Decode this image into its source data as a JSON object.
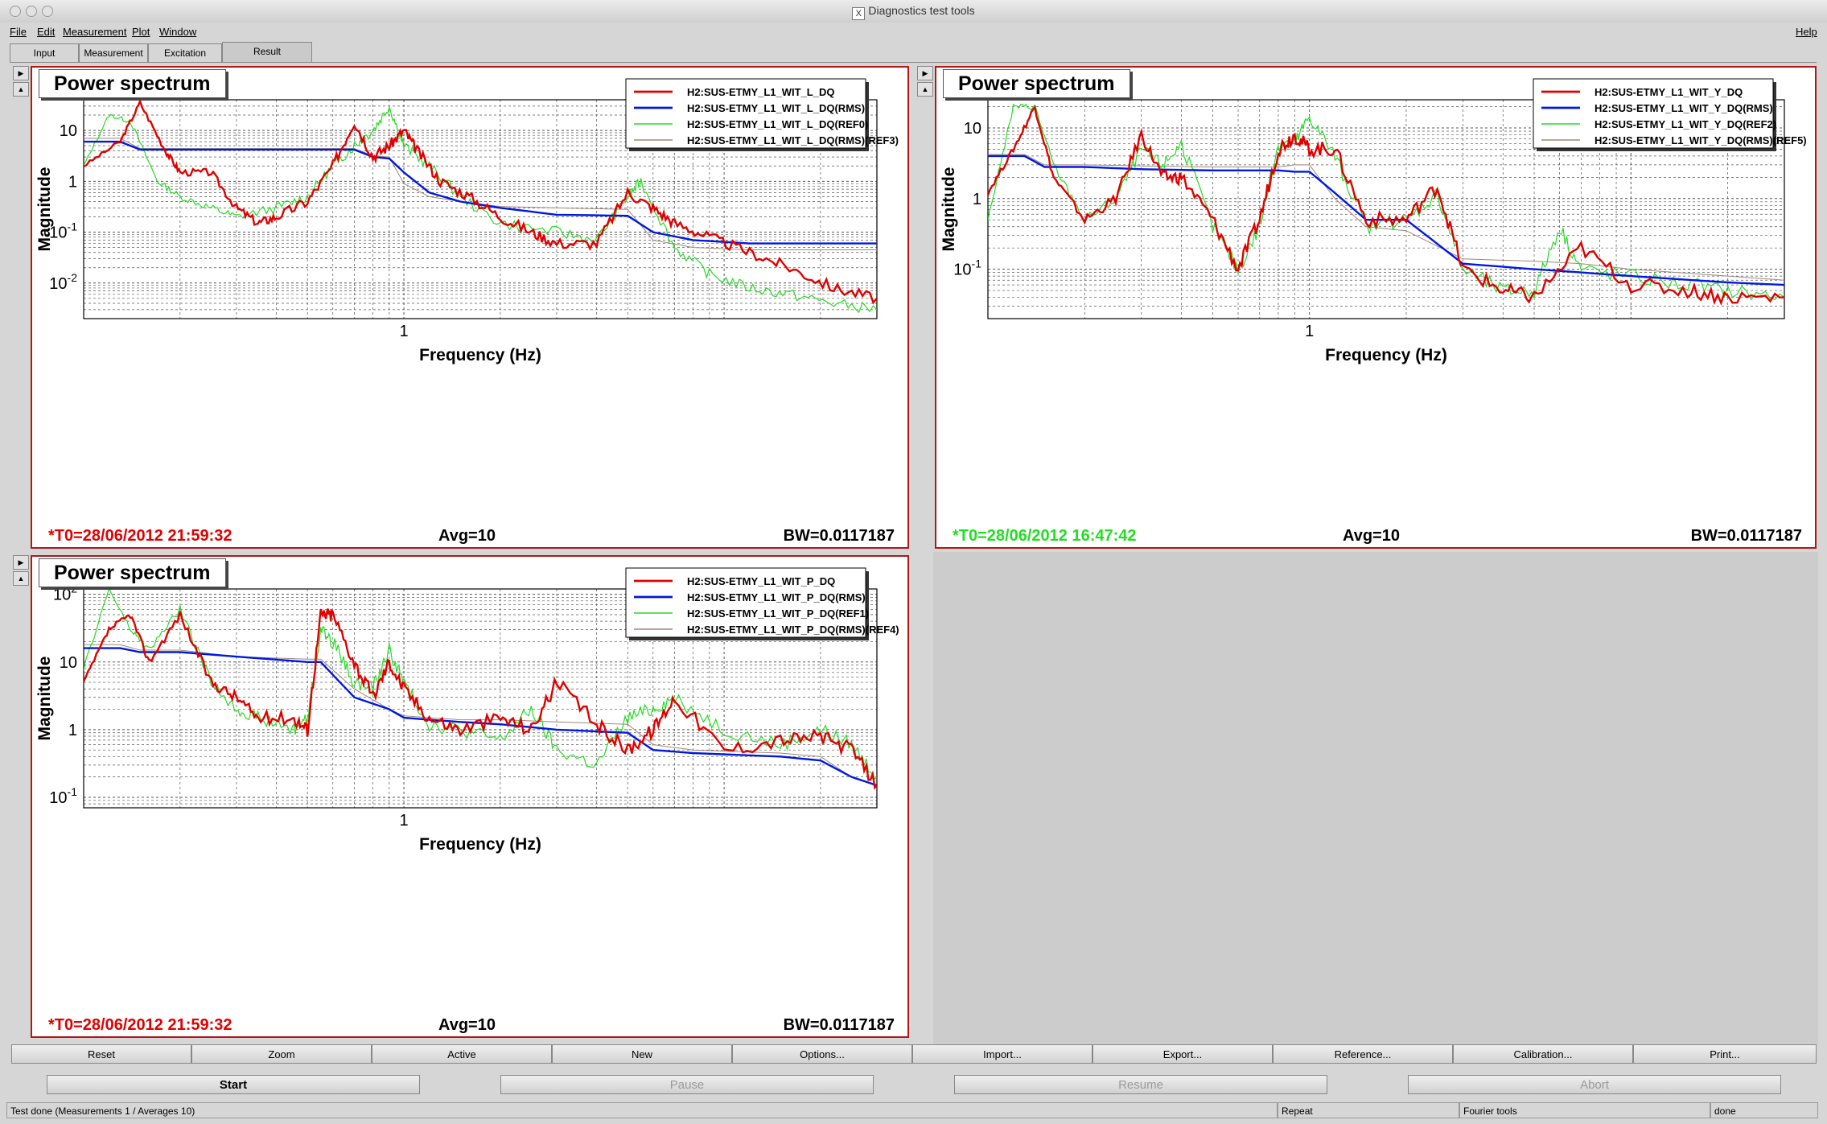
{
  "window": {
    "title": "Diagnostics test tools"
  },
  "menu": {
    "items": [
      "File",
      "Edit",
      "Measurement",
      "Plot",
      "Window"
    ],
    "help": "Help"
  },
  "tabs": [
    {
      "label": "Input",
      "active": false
    },
    {
      "label": "Measurement",
      "active": false
    },
    {
      "label": "Excitation",
      "active": false
    },
    {
      "label": "Result",
      "active": true
    }
  ],
  "colors": {
    "red": "#e00000",
    "blue": "#0018e0",
    "green": "#22dd22",
    "brown": "#a08878",
    "frame": "#b01818"
  },
  "plots": [
    {
      "title": "Power spectrum",
      "ylabel": "Magnitude",
      "xlabel": "Frequency (Hz)",
      "ytick_labels": [
        "10",
        "1",
        "10",
        "10"
      ],
      "ytick_exps": [
        "",
        "",
        "-1",
        "-2"
      ],
      "xtick_label": "1",
      "legend": [
        "H2:SUS-ETMY_L1_WIT_L_DQ",
        "H2:SUS-ETMY_L1_WIT_L_DQ(RMS)",
        "H2:SUS-ETMY_L1_WIT_L_DQ(REF0)",
        "H2:SUS-ETMY_L1_WIT_L_DQ(RMS)(REF3)"
      ],
      "t0": "*T0=28/06/2012 21:59:32",
      "t0_color": "#e00000",
      "avg": "Avg=10",
      "bw": "BW=0.0117187"
    },
    {
      "title": "Power spectrum",
      "ylabel": "Magnitude",
      "xlabel": "Frequency (Hz)",
      "ytick_labels": [
        "10",
        "1",
        "10"
      ],
      "ytick_exps": [
        "",
        "",
        "-1"
      ],
      "xtick_label": "1",
      "legend": [
        "H2:SUS-ETMY_L1_WIT_Y_DQ",
        "H2:SUS-ETMY_L1_WIT_Y_DQ(RMS)",
        "H2:SUS-ETMY_L1_WIT_Y_DQ(REF2)",
        "H2:SUS-ETMY_L1_WIT_Y_DQ(RMS)(REF5)"
      ],
      "t0": "*T0=28/06/2012 16:47:42",
      "t0_color": "#22dd22",
      "avg": "Avg=10",
      "bw": "BW=0.0117187"
    },
    {
      "title": "Power spectrum",
      "ylabel": "Magnitude",
      "xlabel": "Frequency (Hz)",
      "ytick_labels": [
        "10",
        "10",
        "1",
        "10"
      ],
      "ytick_exps": [
        "2",
        "",
        "",
        "-1"
      ],
      "xtick_label": "1",
      "legend": [
        "H2:SUS-ETMY_L1_WIT_P_DQ",
        "H2:SUS-ETMY_L1_WIT_P_DQ(RMS)",
        "H2:SUS-ETMY_L1_WIT_P_DQ(REF1)",
        "H2:SUS-ETMY_L1_WIT_P_DQ(RMS)(REF4)"
      ],
      "t0": "*T0=28/06/2012 21:59:32",
      "t0_color": "#e00000",
      "avg": "Avg=10",
      "bw": "BW=0.0117187"
    }
  ],
  "toolbar": [
    "Reset",
    "Zoom",
    "Active",
    "New",
    "Options...",
    "Import...",
    "Export...",
    "Reference...",
    "Calibration...",
    "Print..."
  ],
  "controls": {
    "start": "Start",
    "pause": "Pause",
    "resume": "Resume",
    "abort": "Abort"
  },
  "status": {
    "message": "Test done (Measurements 1 / Averages 10)",
    "repeat": "Repeat",
    "tool": "Fourier tools",
    "state": "done"
  },
  "chart_data": [
    {
      "type": "line",
      "title": "Power spectrum",
      "xlabel": "Frequency (Hz)",
      "ylabel": "Magnitude",
      "xscale": "log",
      "yscale": "log",
      "xlim": [
        0.1,
        30
      ],
      "ylim": [
        0.002,
        40
      ],
      "series": [
        {
          "name": "H2:SUS-ETMY_L1_WIT_L_DQ",
          "x": [
            0.1,
            0.13,
            0.15,
            0.18,
            0.2,
            0.25,
            0.3,
            0.35,
            0.4,
            0.5,
            0.6,
            0.7,
            0.8,
            0.9,
            1.0,
            1.1,
            1.3,
            1.6,
            2.0,
            2.5,
            3.0,
            4.0,
            5.0,
            6.0,
            7.0,
            9.0,
            12,
            16,
            22,
            30
          ],
          "y": [
            2,
            6,
            35,
            4,
            1.5,
            1.5,
            0.3,
            0.15,
            0.2,
            0.4,
            2,
            15,
            3,
            5,
            10,
            4,
            1,
            0.5,
            0.2,
            0.1,
            0.06,
            0.06,
            0.6,
            0.3,
            0.15,
            0.08,
            0.04,
            0.02,
            0.008,
            0.005
          ]
        },
        {
          "name": "H2:SUS-ETMY_L1_WIT_L_DQ(RMS)",
          "x": [
            0.1,
            0.13,
            0.15,
            0.2,
            0.3,
            0.5,
            0.7,
            0.8,
            0.9,
            1.0,
            1.2,
            1.5,
            2.0,
            3.0,
            5.0,
            6.0,
            8.0,
            12,
            20,
            30
          ],
          "y": [
            6,
            6,
            4.2,
            4.2,
            4.2,
            4.2,
            4.2,
            3,
            2.8,
            1.5,
            0.6,
            0.4,
            0.3,
            0.22,
            0.21,
            0.1,
            0.07,
            0.06,
            0.06,
            0.06
          ]
        },
        {
          "name": "H2:SUS-ETMY_L1_WIT_L_DQ(REF0)",
          "x": [
            0.1,
            0.12,
            0.14,
            0.17,
            0.2,
            0.25,
            0.3,
            0.4,
            0.5,
            0.6,
            0.7,
            0.8,
            0.9,
            1.0,
            1.2,
            1.5,
            2.0,
            3.0,
            4.0,
            5.0,
            5.5,
            7.0,
            9.0,
            12,
            16,
            22,
            30
          ],
          "y": [
            2,
            20,
            15,
            1,
            0.5,
            0.3,
            0.2,
            0.3,
            0.5,
            2,
            5,
            10,
            30,
            5,
            2,
            0.5,
            0.15,
            0.1,
            0.07,
            0.5,
            1,
            0.05,
            0.015,
            0.008,
            0.006,
            0.004,
            0.003
          ]
        },
        {
          "name": "H2:SUS-ETMY_L1_WIT_L_DQ(RMS)(REF3)",
          "x": [
            0.1,
            0.13,
            0.15,
            0.2,
            0.3,
            0.5,
            0.7,
            0.8,
            0.9,
            1.0,
            1.2,
            1.5,
            2.0,
            3.0,
            5.0,
            6.0,
            8.0,
            12,
            20,
            30
          ],
          "y": [
            7,
            7,
            4.4,
            4.4,
            4.4,
            4.4,
            4.4,
            3.2,
            3,
            0.9,
            0.5,
            0.4,
            0.32,
            0.3,
            0.28,
            0.07,
            0.05,
            0.045,
            0.045,
            0.045
          ]
        }
      ]
    },
    {
      "type": "line",
      "title": "Power spectrum",
      "xlabel": "Frequency (Hz)",
      "ylabel": "Magnitude",
      "xscale": "log",
      "yscale": "log",
      "xlim": [
        0.1,
        30
      ],
      "ylim": [
        0.02,
        25
      ],
      "series": [
        {
          "name": "H2:SUS-ETMY_L1_WIT_Y_DQ",
          "x": [
            0.1,
            0.12,
            0.14,
            0.16,
            0.2,
            0.25,
            0.3,
            0.35,
            0.4,
            0.5,
            0.6,
            0.7,
            0.8,
            0.9,
            1.0,
            1.2,
            1.5,
            2.0,
            2.5,
            3.0,
            4.0,
            5.0,
            7.0,
            10,
            15,
            20,
            30
          ],
          "y": [
            1.2,
            5,
            20,
            2,
            0.5,
            1,
            8,
            2,
            2,
            0.5,
            0.1,
            0.5,
            5,
            8,
            5,
            5,
            0.5,
            0.5,
            1.5,
            0.1,
            0.05,
            0.04,
            0.2,
            0.06,
            0.05,
            0.04,
            0.04
          ]
        },
        {
          "name": "H2:SUS-ETMY_L1_WIT_Y_DQ(RMS)",
          "x": [
            0.1,
            0.13,
            0.15,
            0.2,
            0.3,
            0.5,
            0.7,
            0.8,
            0.9,
            1.0,
            1.2,
            1.5,
            2.0,
            3.0,
            5.0,
            7.0,
            10,
            20,
            30
          ],
          "y": [
            4,
            4,
            2.8,
            2.8,
            2.6,
            2.5,
            2.5,
            2.5,
            2.4,
            2.4,
            1.2,
            0.5,
            0.5,
            0.12,
            0.1,
            0.09,
            0.08,
            0.065,
            0.06
          ]
        },
        {
          "name": "H2:SUS-ETMY_L1_WIT_Y_DQ(REF2)",
          "x": [
            0.1,
            0.12,
            0.14,
            0.16,
            0.2,
            0.25,
            0.3,
            0.35,
            0.4,
            0.5,
            0.6,
            0.7,
            0.8,
            0.9,
            1.0,
            1.2,
            1.5,
            2.0,
            2.5,
            3.0,
            4.0,
            5.0,
            6.0,
            7.0,
            10,
            15,
            20,
            30
          ],
          "y": [
            0.5,
            20,
            20,
            3,
            0.5,
            1,
            5,
            3,
            6,
            0.4,
            0.1,
            0.4,
            6,
            6,
            15,
            4,
            0.4,
            0.5,
            1.2,
            0.1,
            0.05,
            0.05,
            0.4,
            0.1,
            0.08,
            0.06,
            0.05,
            0.04
          ]
        },
        {
          "name": "H2:SUS-ETMY_L1_WIT_Y_DQ(RMS)(REF5)",
          "x": [
            0.1,
            0.13,
            0.15,
            0.2,
            0.3,
            0.5,
            0.7,
            0.8,
            0.9,
            1.0,
            1.2,
            1.5,
            2.0,
            3.0,
            5.0,
            7.0,
            10,
            20,
            30
          ],
          "y": [
            4.2,
            4.2,
            3,
            3,
            2.9,
            2.8,
            2.8,
            2.8,
            3,
            3,
            1,
            0.4,
            0.35,
            0.14,
            0.13,
            0.12,
            0.1,
            0.08,
            0.07
          ]
        }
      ]
    },
    {
      "type": "line",
      "title": "Power spectrum",
      "xlabel": "Frequency (Hz)",
      "ylabel": "Magnitude",
      "xscale": "log",
      "yscale": "log",
      "xlim": [
        0.1,
        30
      ],
      "ylim": [
        0.07,
        120
      ],
      "series": [
        {
          "name": "H2:SUS-ETMY_L1_WIT_P_DQ",
          "x": [
            0.1,
            0.12,
            0.14,
            0.16,
            0.2,
            0.25,
            0.3,
            0.35,
            0.45,
            0.5,
            0.55,
            0.6,
            0.7,
            0.8,
            0.9,
            1.0,
            1.2,
            1.5,
            2.0,
            2.5,
            3.0,
            4.0,
            5.0,
            6.0,
            7.0,
            10,
            15,
            20,
            25,
            30
          ],
          "y": [
            5,
            30,
            50,
            10,
            50,
            5,
            3,
            1.5,
            1.5,
            1.0,
            50,
            50,
            10,
            3,
            10,
            4,
            1.5,
            1.0,
            1.5,
            1.0,
            5,
            1.2,
            0.5,
            1.0,
            3,
            0.5,
            0.7,
            0.8,
            0.5,
            0.15
          ]
        },
        {
          "name": "H2:SUS-ETMY_L1_WIT_P_DQ(RMS)",
          "x": [
            0.1,
            0.13,
            0.15,
            0.2,
            0.3,
            0.5,
            0.55,
            0.7,
            0.9,
            1.0,
            1.2,
            1.5,
            2.0,
            3.0,
            5.0,
            6.0,
            8.0,
            15,
            20,
            25,
            30
          ],
          "y": [
            16,
            16,
            14,
            14,
            12,
            10,
            10,
            3,
            2,
            1.5,
            1.4,
            1.3,
            1.2,
            1.0,
            0.9,
            0.5,
            0.45,
            0.4,
            0.35,
            0.2,
            0.15
          ]
        },
        {
          "name": "H2:SUS-ETMY_L1_WIT_P_DQ(REF1)",
          "x": [
            0.1,
            0.12,
            0.14,
            0.16,
            0.2,
            0.25,
            0.3,
            0.35,
            0.45,
            0.5,
            0.55,
            0.6,
            0.7,
            0.8,
            0.9,
            1.0,
            1.2,
            1.5,
            2.0,
            2.5,
            3.0,
            4.0,
            5.0,
            6.0,
            7.0,
            10,
            15,
            20,
            25,
            30
          ],
          "y": [
            8,
            120,
            30,
            15,
            60,
            5,
            2,
            1.5,
            1.0,
            1.5,
            30,
            20,
            5,
            4,
            15,
            5,
            1.2,
            1.0,
            0.7,
            2.0,
            0.5,
            0.3,
            1.5,
            2.0,
            3,
            1,
            0.6,
            1,
            0.6,
            0.2
          ]
        },
        {
          "name": "H2:SUS-ETMY_L1_WIT_P_DQ(RMS)(REF4)",
          "x": [
            0.1,
            0.13,
            0.15,
            0.2,
            0.3,
            0.5,
            0.55,
            0.7,
            0.9,
            1.0,
            1.2,
            1.5,
            2.0,
            3.0,
            5.0,
            6.0,
            8.0,
            15,
            20,
            25,
            30
          ],
          "y": [
            18,
            18,
            15,
            15,
            12,
            11,
            11,
            4,
            2,
            1.6,
            1.5,
            1.4,
            1.4,
            1.3,
            1.2,
            0.6,
            0.5,
            0.45,
            0.4,
            0.2,
            0.15
          ]
        }
      ]
    }
  ]
}
